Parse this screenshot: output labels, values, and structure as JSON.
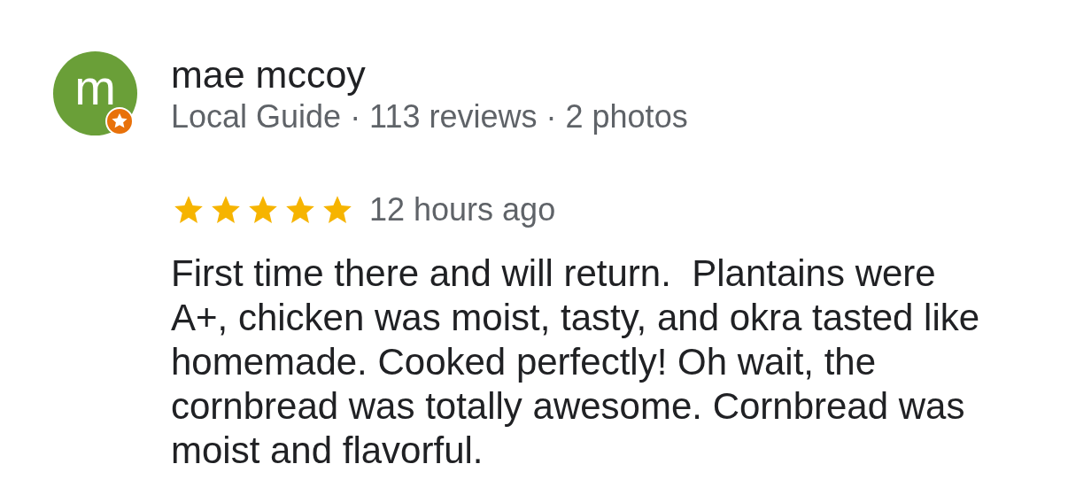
{
  "review": {
    "author": {
      "initial": "m",
      "name": "mae mccoy",
      "details": "Local Guide · 113 reviews · 2 photos",
      "local_guide": true
    },
    "stars": 5,
    "time": "12 hours ago",
    "text": "First time there and will return.  Plantains were A+, chicken was moist, tasty, and okra tasted like homemade. Cooked perfectly! Oh wait, the cornbread was totally awesome. Cornbread was moist and flavorful."
  }
}
